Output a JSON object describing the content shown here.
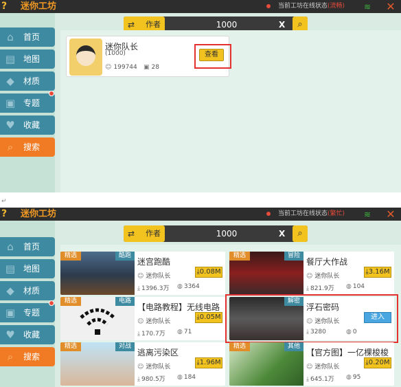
{
  "app": {
    "title": "迷你工坊",
    "status_label": "当前工坊在线状态",
    "status_value_top": "(流畅)",
    "status_value_bottom": "(繁忙)",
    "help": "?",
    "close": "✕",
    "wifi": "≋"
  },
  "sidebar": {
    "items": [
      {
        "label": "首页",
        "icon": "home-icon",
        "glyph": "⌂"
      },
      {
        "label": "地图",
        "icon": "map-icon",
        "glyph": "▤"
      },
      {
        "label": "材质",
        "icon": "texture-icon",
        "glyph": "◆"
      },
      {
        "label": "专题",
        "icon": "topic-icon",
        "glyph": "▣"
      },
      {
        "label": "收藏",
        "icon": "favorite-icon",
        "glyph": "♥"
      },
      {
        "label": "搜索",
        "icon": "search-icon",
        "glyph": "⌕"
      }
    ]
  },
  "search": {
    "filter_label": "作者",
    "filter_icon": "⇄",
    "value": "1000",
    "clear": "X",
    "go": "⌕"
  },
  "author_card": {
    "name": "迷你队长",
    "id": "(1000)",
    "followers": "199744",
    "works": "28",
    "view_button": "查看"
  },
  "separator": "↵",
  "maps": [
    {
      "tag": "精选",
      "category": "酷跑",
      "title": "迷宫跑酷",
      "author": "迷你队长",
      "size": "0.08M",
      "downloads": "1396.3万",
      "plays": "3364"
    },
    {
      "tag": "精选",
      "category": "冒险",
      "title": "餐厅大作战",
      "author": "迷你队长",
      "size": "3.16M",
      "downloads": "821.9万",
      "plays": "104"
    },
    {
      "tag": "精选",
      "category": "电路",
      "title": "【电路教程】无线电路",
      "author": "迷你队长",
      "size": "0.05M",
      "downloads": "170.7万",
      "plays": "71"
    },
    {
      "tag": "",
      "category": "解密",
      "title": "浮石密码",
      "author": "迷你队长",
      "action": "进入",
      "downloads": "3280",
      "plays": "0"
    },
    {
      "tag": "精选",
      "category": "对战",
      "title": "逃离污染区",
      "author": "迷你队长",
      "size": "1.96M",
      "downloads": "980.5万",
      "plays": "184"
    },
    {
      "tag": "精选",
      "category": "其他",
      "title": "【官方图】一亿棵梭梭",
      "author": "迷你队长",
      "size": "0.20M",
      "downloads": "645.1万",
      "plays": "95"
    }
  ],
  "colors": {
    "accent_yellow": "#f2c21f",
    "nav_blue": "#3e8aa1",
    "nav_active": "#f07b24",
    "highlight_red": "#e53030"
  }
}
